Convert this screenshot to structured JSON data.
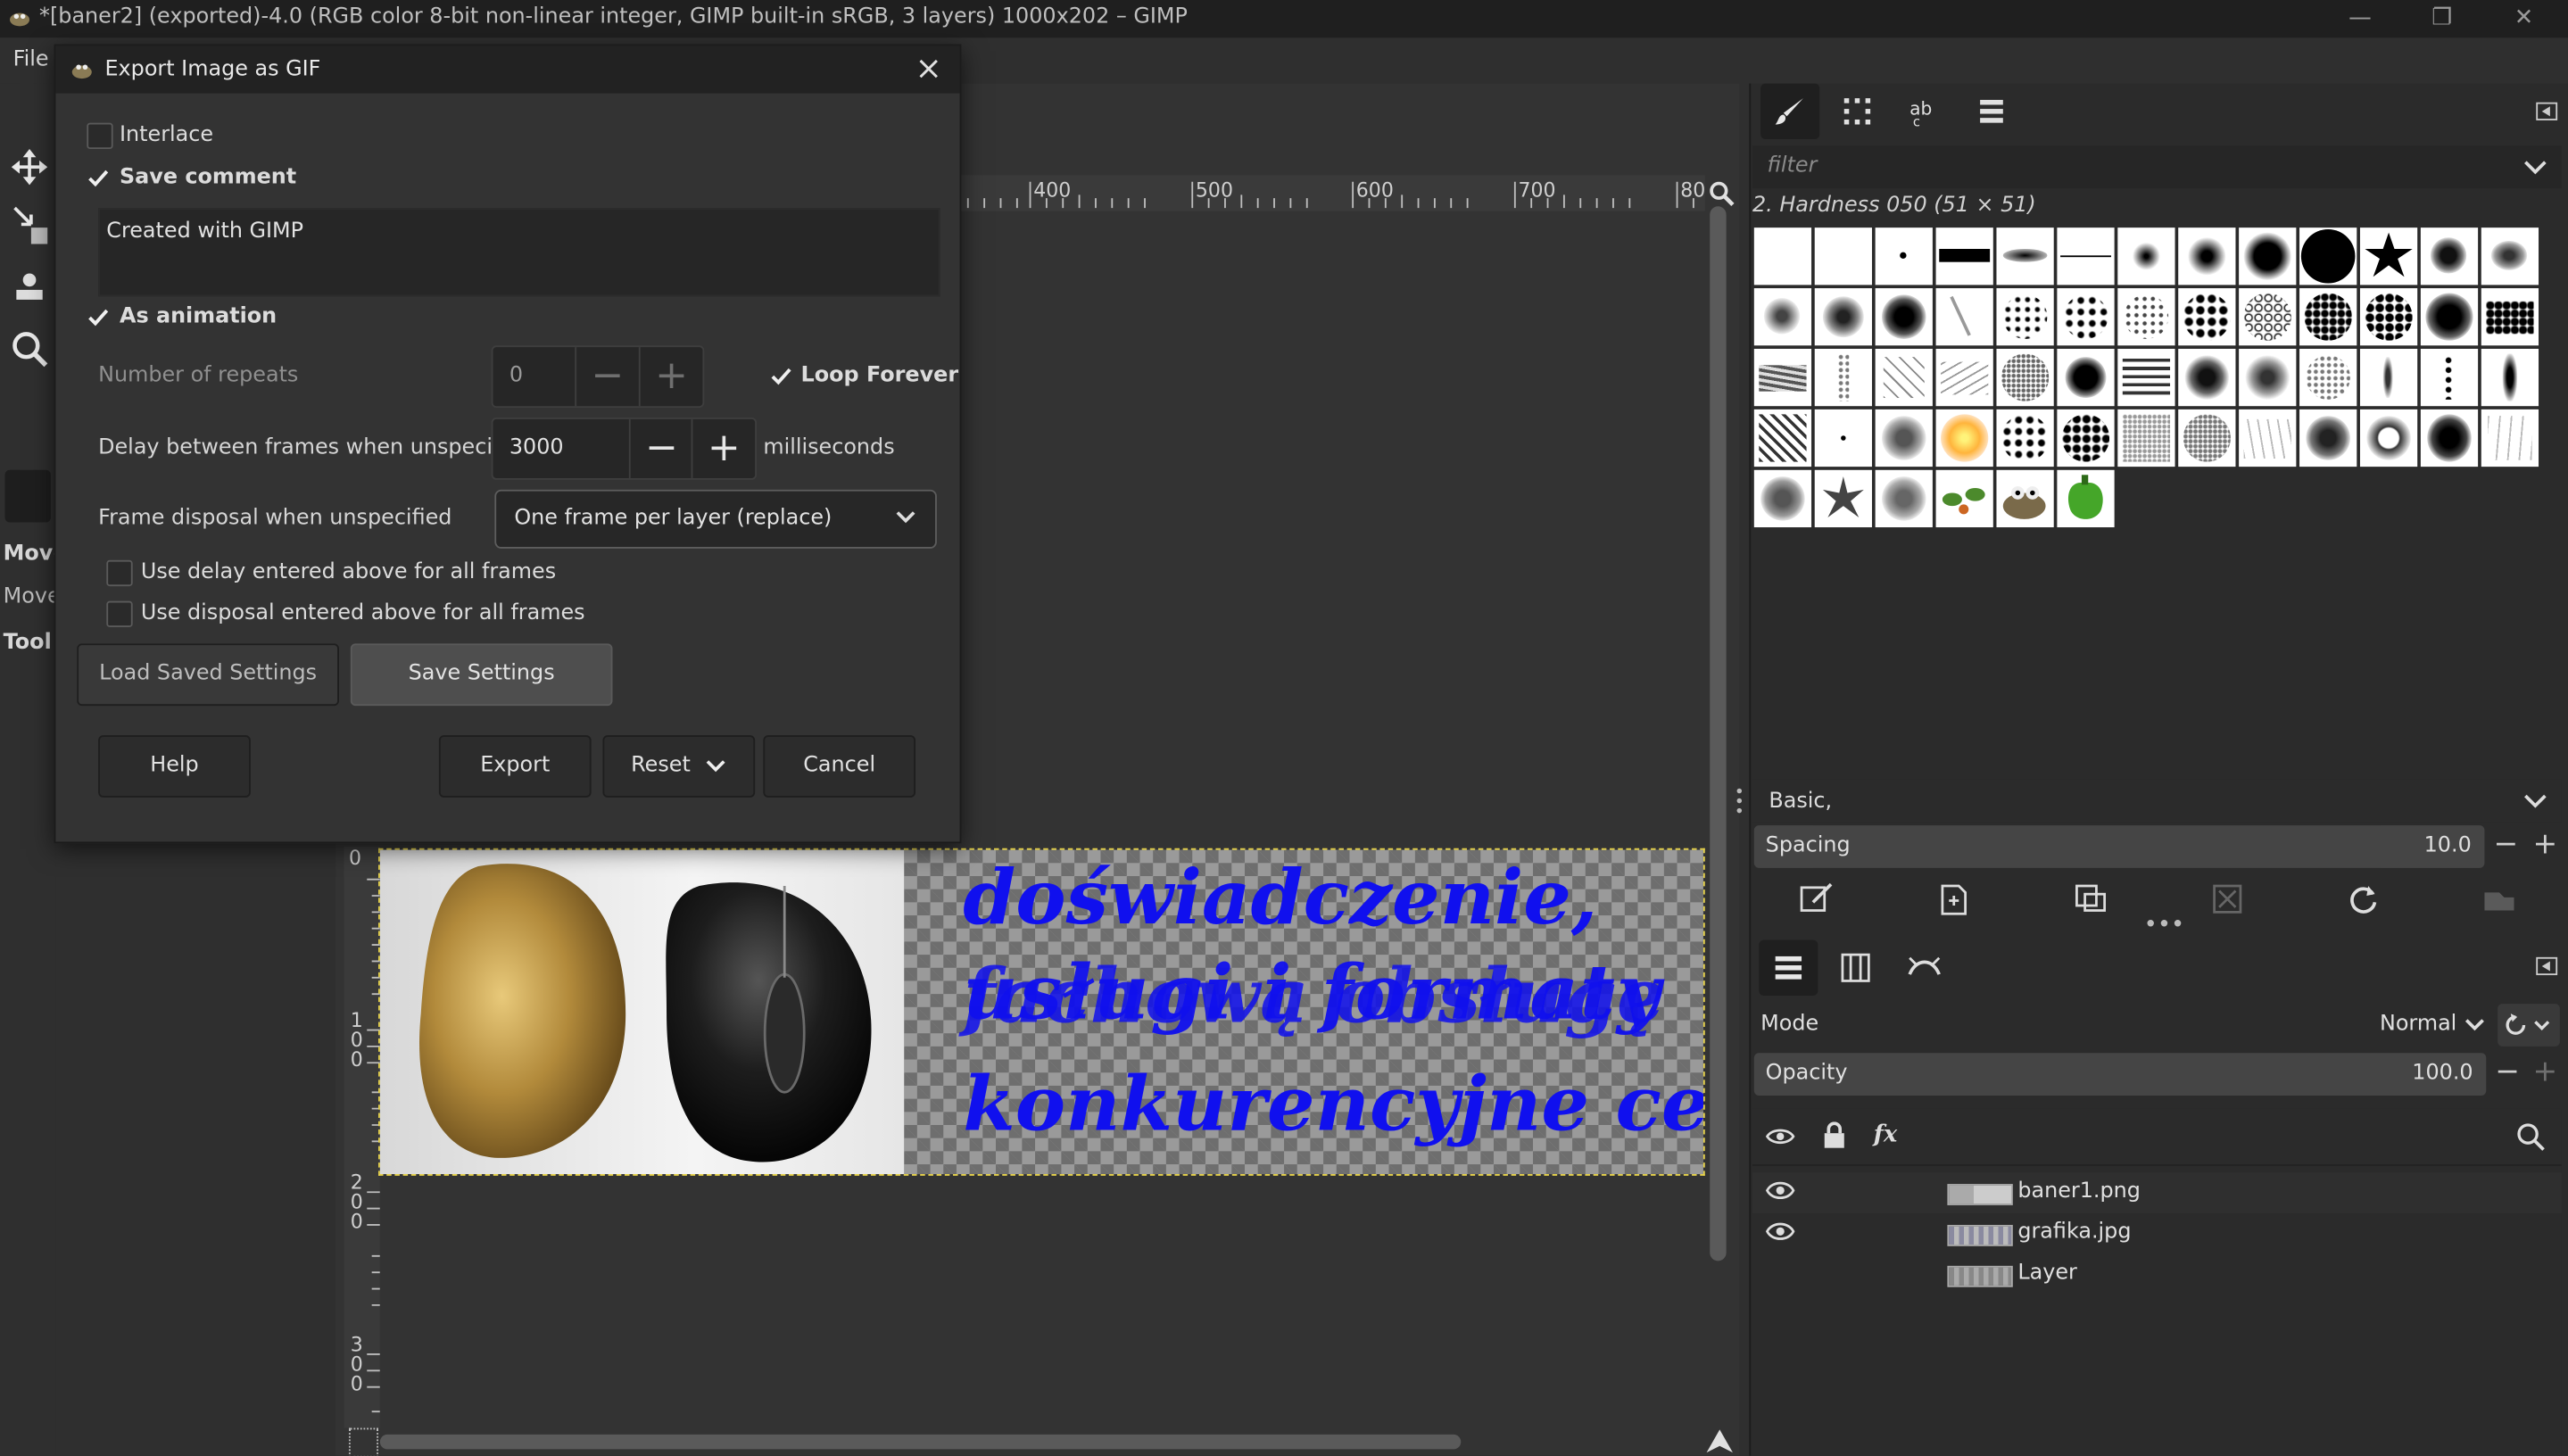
{
  "window": {
    "title": "*[baner2] (exported)-4.0 (RGB color 8-bit non-linear integer, GIMP built-in sRGB, 3 layers) 1000x202 – GIMP",
    "controls": {
      "minimize": "—",
      "restore": "❐",
      "close": "✕"
    }
  },
  "menubar": {
    "file": "File"
  },
  "toolbox": {
    "labels": [
      "Move",
      "Move",
      "Tool"
    ]
  },
  "canvas": {
    "ruler_top": [
      "400",
      "500",
      "600",
      "700",
      "80"
    ],
    "ruler_left": [
      [
        "1",
        "0",
        "0"
      ],
      [
        "2",
        "0",
        "0"
      ],
      [
        "3",
        "0",
        "0"
      ]
    ],
    "ruler_origin": "0",
    "banner_lines": [
      "doświadczenie,",
      "usługi i formaty",
      "fachową obsługę",
      "konkurencyjne ceny"
    ]
  },
  "dialog": {
    "title": "Export Image as GIF",
    "interlace": {
      "label": "Interlace",
      "checked": false
    },
    "save_comment": {
      "label": "Save comment",
      "checked": true
    },
    "comment_text": "Created with GIMP",
    "as_animation": {
      "label": "As animation",
      "checked": true
    },
    "repeats": {
      "label": "Number of repeats",
      "value": "0"
    },
    "loop_forever": {
      "label": "Loop Forever",
      "checked": true
    },
    "delay": {
      "label": "Delay between frames when unspecified",
      "value": "3000",
      "unit": "milliseconds"
    },
    "disposal": {
      "label": "Frame disposal when unspecified",
      "value": "One frame per layer (replace)"
    },
    "use_delay": {
      "label": "Use delay entered above for all frames",
      "checked": false
    },
    "use_disposal": {
      "label": "Use disposal entered above for all frames",
      "checked": false
    },
    "buttons": {
      "load": "Load Saved Settings",
      "save": "Save Settings",
      "help": "Help",
      "export": "Export",
      "reset": "Reset",
      "cancel": "Cancel"
    }
  },
  "brushes": {
    "filter_placeholder": "filter",
    "current": "2. Hardness 050 (51 × 51)",
    "preset": "Basic,",
    "spacing_label": "Spacing",
    "spacing_value": "10.0"
  },
  "layers": {
    "mode_label": "Mode",
    "mode_value": "Normal",
    "opacity_label": "Opacity",
    "opacity_value": "100.0",
    "fx": "fx",
    "items": [
      {
        "name": "baner1.png",
        "visible": true
      },
      {
        "name": "grafika.jpg",
        "visible": true
      },
      {
        "name": "Layer",
        "visible": false
      }
    ]
  },
  "colors": {
    "accent_text": "#1010ee",
    "selection_outline": "#e6d24a"
  }
}
